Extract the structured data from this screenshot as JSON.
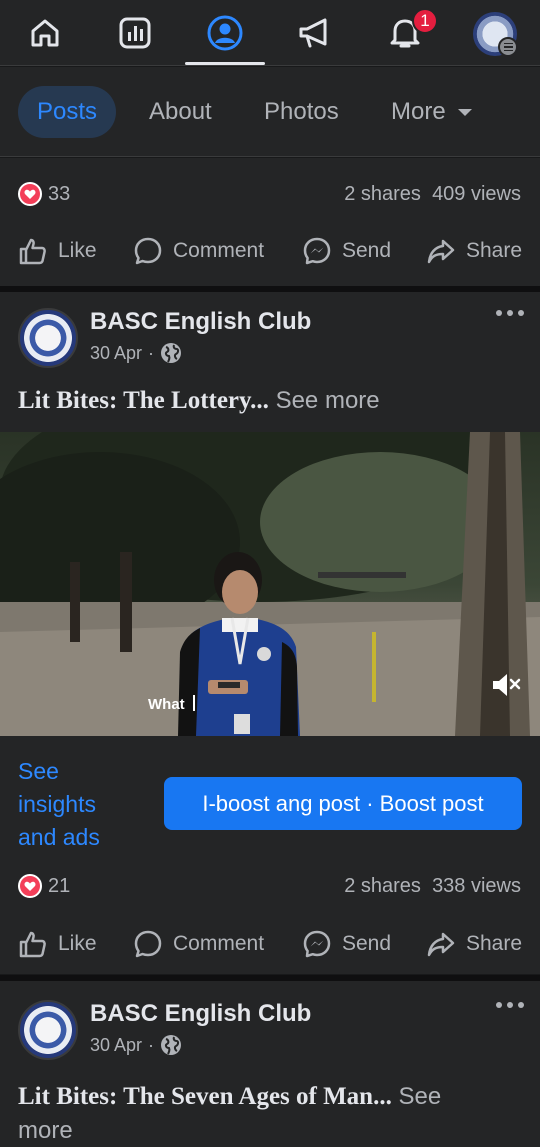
{
  "nav": {
    "notification_count": "1",
    "icons": [
      "home-icon",
      "chart-icon",
      "profile-icon",
      "megaphone-icon",
      "bell-icon",
      "avatar"
    ]
  },
  "tabs": {
    "posts": "Posts",
    "about": "About",
    "photos": "Photos",
    "more": "More"
  },
  "post1": {
    "reactions": "33",
    "shares": "2 shares",
    "views": "409 views"
  },
  "actions": {
    "like": "Like",
    "comment": "Comment",
    "send": "Send",
    "share": "Share"
  },
  "post2": {
    "page_name": "BASC English Club",
    "date": "30 Apr",
    "title": "Lit Bites: The Lottery...",
    "see_more": "See more",
    "video_caption": "What",
    "insights": "See insights and ads",
    "boost": "I-boost ang post · Boost post",
    "reactions": "21",
    "shares": "2 shares",
    "views": "338 views"
  },
  "post3": {
    "page_name": "BASC English Club",
    "date": "30 Apr",
    "title": "Lit Bites: The Seven Ages of Man...",
    "see_more_1": "See",
    "see_more_2": "more"
  },
  "colors": {
    "accent": "#2d88ff",
    "boost_button": "#1877f2",
    "heart": "#f33e58",
    "badge": "#e41e3f"
  }
}
